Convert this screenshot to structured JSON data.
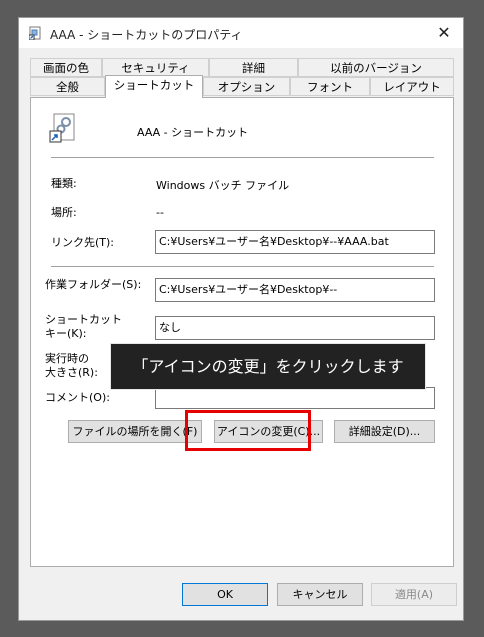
{
  "window": {
    "title": "AAA - ショートカットのプロパティ",
    "close_glyph": "✕"
  },
  "tabs": {
    "row1": [
      "画面の色",
      "セキュリティ",
      "詳細",
      "以前のバージョン"
    ],
    "row2": [
      "全般",
      "ショートカット",
      "オプション",
      "フォント",
      "レイアウト"
    ],
    "active": "ショートカット"
  },
  "shortcut": {
    "name": "AAA - ショートカット",
    "type_label": "種類:",
    "type_value": "Windows バッチ ファイル",
    "location_label": "場所:",
    "location_value": "--",
    "target_label": "リンク先(T):",
    "target_value": "C:¥Users¥ユーザー名¥Desktop¥--¥AAA.bat",
    "workdir_label": "作業フォルダー(S):",
    "workdir_value": "C:¥Users¥ユーザー名¥Desktop¥--",
    "hotkey_label_1": "ショートカット",
    "hotkey_label_2": "キー(K):",
    "hotkey_value": "なし",
    "run_label_1": "実行時の",
    "run_label_2": "大きさ(R):",
    "comment_label": "コメント(O):",
    "comment_value": ""
  },
  "buttons": {
    "open_location": "ファイルの場所を開く(F)",
    "change_icon": "アイコンの変更(C)...",
    "advanced": "詳細設定(D)...",
    "ok": "OK",
    "cancel": "キャンセル",
    "apply": "適用(A)"
  },
  "annotation": {
    "tooltip": "「アイコンの変更」をクリックします",
    "highlight_color": "#e60000"
  }
}
